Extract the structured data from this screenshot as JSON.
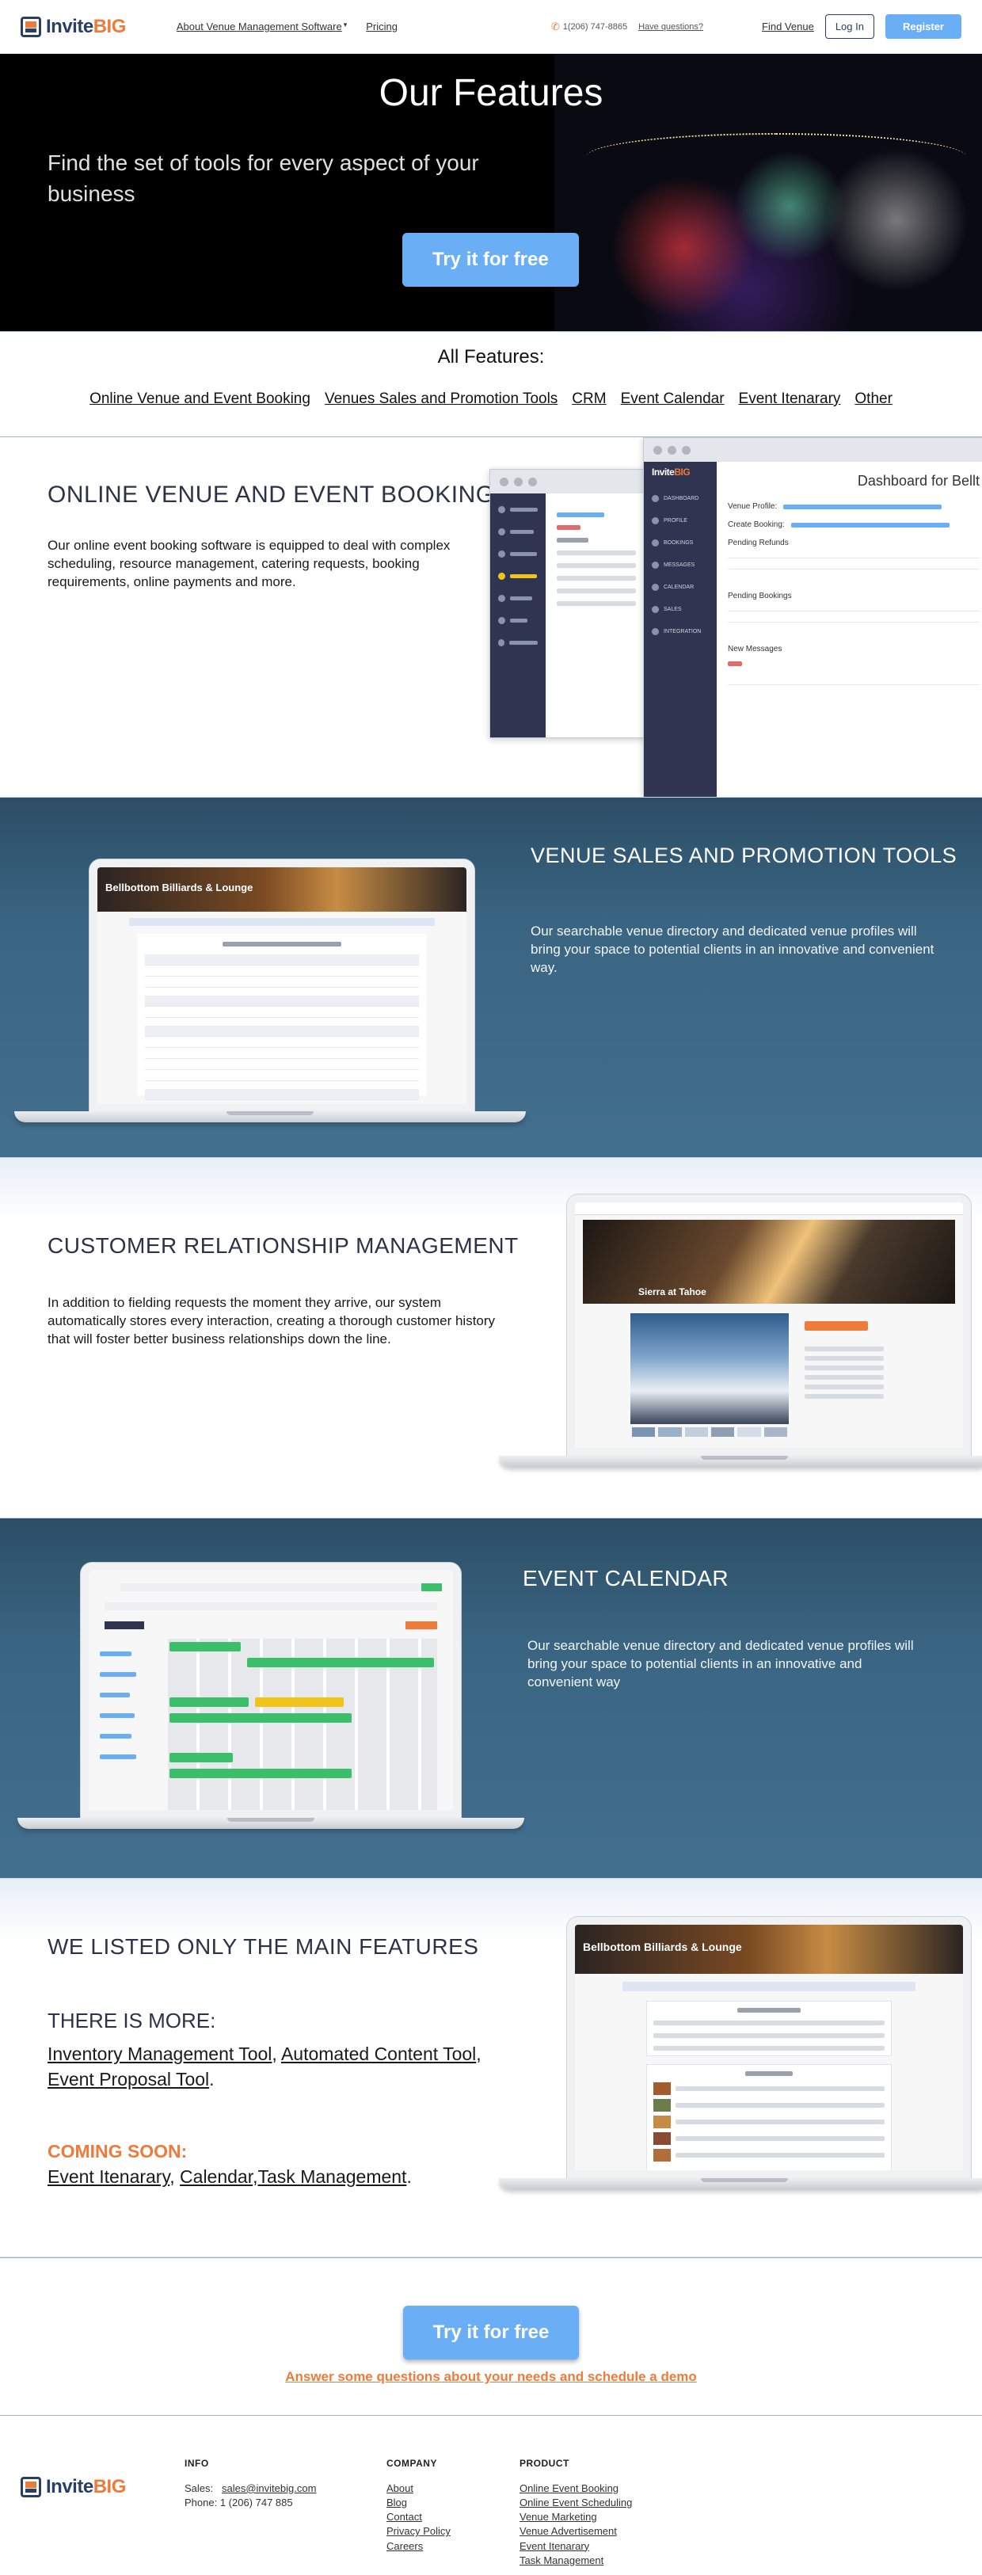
{
  "header": {
    "logo_invite": "Invite",
    "logo_big": "BIG",
    "nav": [
      "About Venue Management Software",
      "Pricing"
    ],
    "phone": "1(206) 747-8865",
    "questions": "Have questions?",
    "find_venue": "Find Venue",
    "login": "Log In",
    "register": "Register"
  },
  "hero": {
    "title": "Our Features",
    "tagline": "Find the set of tools for every aspect of your business",
    "cta": "Try it for free"
  },
  "all_features": {
    "title": "All Features:",
    "links": [
      "Online Venue and Event Booking",
      "Venues Sales and Promotion Tools",
      "CRM",
      "Event Calendar",
      "Event Itenarary",
      "Other"
    ]
  },
  "sections": {
    "booking": {
      "title": "ONLINE VENUE AND EVENT BOOKING",
      "text": "Our online event booking software is equipped to deal with complex scheduling, resource management, catering requests, booking requirements, online payments and more.",
      "mock_heading": "Dashboard for Bellt",
      "mock_labels": [
        "Venue Profile:",
        "Create Booking:",
        "Pending Refunds",
        "Pending Bookings",
        "New Messages"
      ],
      "mock_sidebar": [
        "DASHBOARD",
        "PROFILE",
        "BOOKINGS",
        "MESSAGES",
        "CALENDAR",
        "SALES",
        "INTEGRATION"
      ]
    },
    "sales": {
      "title": "VENUE SALES AND PROMOTION TOOLS",
      "text": "Our searchable venue directory and dedicated venue profiles will bring your space to potential clients in an innovative and convenient way.",
      "mock_banner": "Bellbottom Billiards & Lounge"
    },
    "crm": {
      "title": "CUSTOMER RELATIONSHIP MANAGEMENT",
      "text": "In addition to fielding requests the moment they arrive, our system automatically stores every interaction, creating a thorough customer history that will foster better business relationships down the line.",
      "mock_banner": "Sierra at Tahoe"
    },
    "calendar": {
      "title": "EVENT CALENDAR",
      "text": "Our searchable venue directory and dedicated venue profiles will bring your space to potential clients in an innovative and convenient way"
    },
    "more": {
      "title": "WE LISTED ONLY THE MAIN FEATURES",
      "subhead": "THERE IS MORE:",
      "links": [
        "Inventory Management Tool",
        "Automated Content Tool",
        "Event Proposal  Tool"
      ],
      "coming_soon": "COMING SOON:",
      "soon_links": [
        "Event Itenarary",
        "Calendar",
        "Task Management"
      ],
      "mock_banner": "Bellbottom Billiards & Lounge"
    }
  },
  "cta": {
    "button": "Try it for free",
    "link": "Answer some questions about your needs and schedule a demo"
  },
  "footer": {
    "info": {
      "title": "INFO",
      "sales_label": "Sales:",
      "sales_email": "sales@invitebig.com",
      "phone": "Phone: 1 (206) 747 885"
    },
    "company": {
      "title": "COMPANY",
      "links": [
        "About",
        "Blog",
        "Contact",
        "Privacy Policy",
        "Careers"
      ]
    },
    "product": {
      "title": "PRODUCT",
      "links": [
        "Online Event Booking",
        "Online Event Scheduling",
        "Venue Marketing",
        "Venue Advertisement",
        "Event Itenarary",
        "Task Management"
      ]
    }
  },
  "colors": {
    "accent_orange": "#ef7b3a",
    "accent_blue": "#6aaef6",
    "navy": "#2b3f66",
    "section_blue": "#3a6582"
  }
}
